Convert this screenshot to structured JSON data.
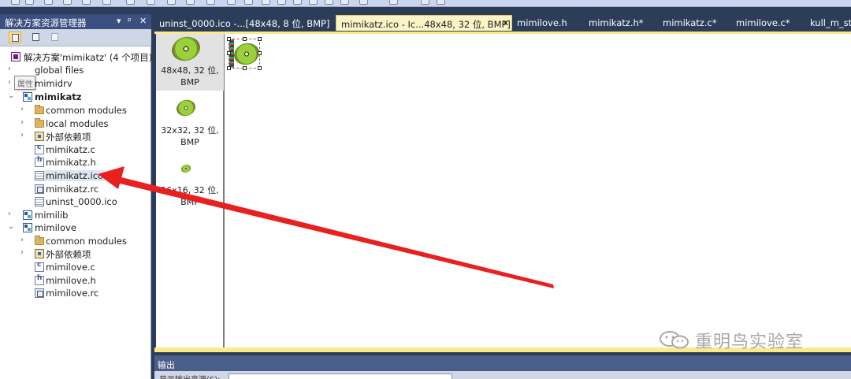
{
  "explorer": {
    "title": "解决方案资源管理器",
    "pin_glyph": "▾ ᵖ ✕",
    "solution_label": "解决方案'mimikatz' (4 个项目)",
    "tooltip": "属性",
    "tree": [
      {
        "label": "global files",
        "icon": "folder-icon",
        "kind": "filter"
      },
      {
        "label": "mimidrv",
        "icon": "project-icon",
        "kind": "project"
      },
      {
        "label": "mimikatz",
        "icon": "project-icon",
        "kind": "project"
      },
      {
        "label": "common modules",
        "icon": "folder-icon",
        "kind": "filter"
      },
      {
        "label": "local modules",
        "icon": "folder-icon",
        "kind": "filter"
      },
      {
        "label": "外部依赖项",
        "icon": "dependencies-icon",
        "kind": "dependencies"
      },
      {
        "label": "mimikatz.c",
        "icon": "c-file-icon",
        "kind": "file"
      },
      {
        "label": "mimikatz.h",
        "icon": "h-file-icon",
        "kind": "file"
      },
      {
        "label": "mimikatz.ico",
        "icon": "image-file-icon",
        "kind": "file"
      },
      {
        "label": "mimikatz.rc",
        "icon": "rc-file-icon",
        "kind": "file"
      },
      {
        "label": "uninst_0000.ico",
        "icon": "image-file-icon",
        "kind": "file"
      },
      {
        "label": "mimilib",
        "icon": "project-icon",
        "kind": "project"
      },
      {
        "label": "mimilove",
        "icon": "project-icon",
        "kind": "project"
      },
      {
        "label": "common modules",
        "icon": "folder-icon",
        "kind": "filter"
      },
      {
        "label": "外部依赖项",
        "icon": "dependencies-icon",
        "kind": "dependencies"
      },
      {
        "label": "mimilove.c",
        "icon": "c-file-icon",
        "kind": "file"
      },
      {
        "label": "mimilove.h",
        "icon": "h-file-icon",
        "kind": "file"
      },
      {
        "label": "mimilove.rc",
        "icon": "rc-file-icon",
        "kind": "file"
      }
    ]
  },
  "tabs": [
    {
      "label": "uninst_0000.ico -...[48x48, 8 位, BMP]",
      "active": false
    },
    {
      "label": "mimikatz.ico - Ic...48x48, 32 位, BMP]",
      "active": true,
      "close": "✕"
    },
    {
      "label": "mimilove.h",
      "active": false
    },
    {
      "label": "mimikatz.h*",
      "active": false
    },
    {
      "label": "mimikatz.c*",
      "active": false
    },
    {
      "label": "mimilove.c*",
      "active": false
    },
    {
      "label": "kull_m_str",
      "active": false
    }
  ],
  "icon_formats": [
    {
      "line1": "48x48, 32 位,",
      "line2": "BMP",
      "selected": true
    },
    {
      "line1": "32x32, 32 位,",
      "line2": "BMP",
      "selected": false
    },
    {
      "line1": "16x16, 32 位,",
      "line2": "BMP",
      "selected": false
    }
  ],
  "output": {
    "title": "输出",
    "show_output_from": "显示输出来源(S):"
  },
  "watermark": {
    "text": "重明鸟实验室"
  },
  "colors": {
    "title_bar": "#3b4f81",
    "annotation_arrow": "#e8201f",
    "active_tab": "#fcf3c7"
  }
}
